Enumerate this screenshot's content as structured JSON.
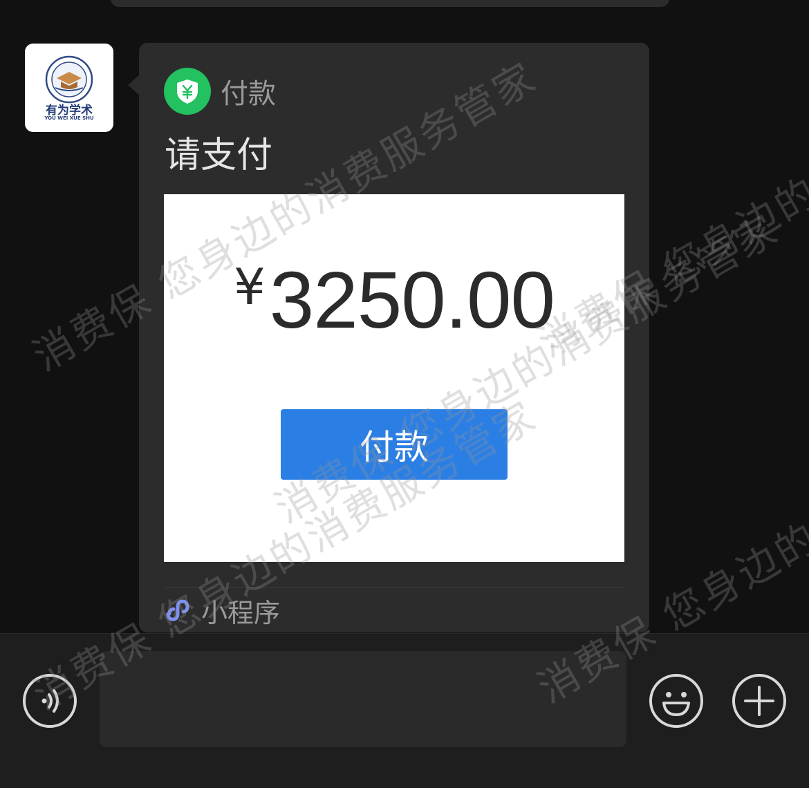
{
  "avatar": {
    "org_name": "有为学术",
    "org_name_en": "YOU WEI XUE SHU"
  },
  "card": {
    "source_label": "付款",
    "title": "请支付",
    "preview": {
      "currency_symbol": "¥",
      "amount": "3250.00",
      "button_label": "付款"
    },
    "footer_label": "小程序"
  },
  "watermarks": [
    "消费保 您身边的消费服务管家",
    "消费保 您身边的消费服务管家",
    "消费保 您身边的消费服务管家",
    "消费保 您身边的消费服务管家",
    "消费保 您身边的消费服务管家"
  ],
  "icons": {
    "pay": "yuan-shield-icon",
    "miniprogram": "miniprogram-link-icon",
    "voice": "voice-icon",
    "emoji": "emoji-icon",
    "plus": "plus-icon"
  },
  "colors": {
    "pay_green": "#23c160",
    "button_blue": "#2b7fe4",
    "miniprogram_purple": "#7d90ef"
  }
}
